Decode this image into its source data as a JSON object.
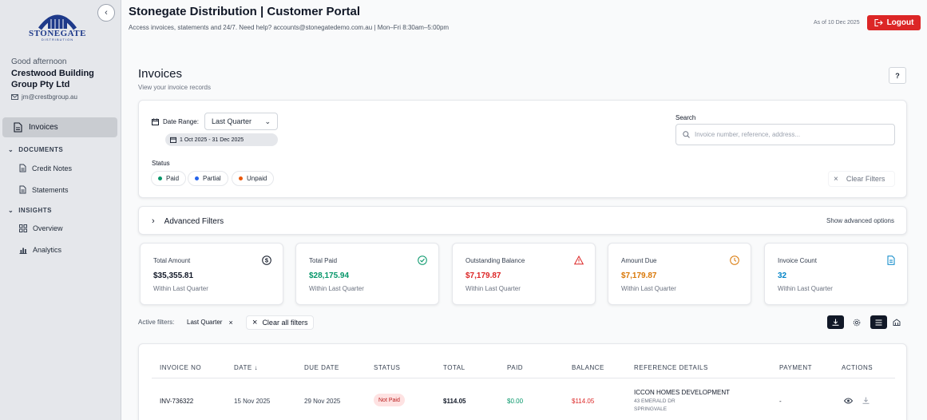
{
  "app": {
    "title": "Stonegate Distribution | Customer Portal",
    "subtitle": "Access invoices, statements and 24/7. Need help? accounts@stonegatedemo.com.au | Mon–Fri 8:30am–5:00pm",
    "as_of": "As of 10 Dec 2025",
    "logout_label": "Logout",
    "logo_text": "STONEGATE",
    "logo_sub": "DISTRIBUTION"
  },
  "user": {
    "greeting": "Good afternoon",
    "company": "Crestwood Building Group Pty Ltd",
    "email": "jm@crestbgroup.au"
  },
  "sidebar": {
    "active_item": "Invoices",
    "sections": [
      {
        "label": "DOCUMENTS",
        "items": [
          "Credit Notes",
          "Statements"
        ]
      },
      {
        "label": "INSIGHTS",
        "items": [
          "Overview",
          "Analytics"
        ]
      }
    ]
  },
  "page": {
    "title": "Invoices",
    "subtitle": "View your invoice records",
    "help_label": "?"
  },
  "filters": {
    "date_range_label": "Date Range:",
    "date_range_value": "Last Quarter",
    "date_span": "1 Oct 2025 - 31 Dec 2025",
    "search_label": "Search",
    "search_placeholder": "Invoice number, reference, address...",
    "status_label": "Status",
    "statuses": [
      {
        "label": "Paid",
        "color": "#059669"
      },
      {
        "label": "Partial",
        "color": "#2563eb"
      },
      {
        "label": "Unpaid",
        "color": "#ea580c"
      }
    ],
    "clear_label": "Clear Filters",
    "advanced_label": "Advanced Filters",
    "advanced_right": "Show advanced options"
  },
  "stats": [
    {
      "label": "Total Amount",
      "value": "$35,355.81",
      "sub": "Within Last Quarter",
      "color": "#111827",
      "icon": "dollar-icon"
    },
    {
      "label": "Total Paid",
      "value": "$28,175.94",
      "sub": "Within Last Quarter",
      "color": "#059669",
      "icon": "check-circle-icon"
    },
    {
      "label": "Outstanding Balance",
      "value": "$7,179.87",
      "sub": "Within Last Quarter",
      "color": "#dc2626",
      "icon": "warning-icon"
    },
    {
      "label": "Amount Due",
      "value": "$7,179.87",
      "sub": "Within Last Quarter",
      "color": "#d97706",
      "icon": "clock-icon"
    },
    {
      "label": "Invoice Count",
      "value": "32",
      "sub": "Within Last Quarter",
      "color": "#0284c7",
      "icon": "document-icon"
    }
  ],
  "active_filters": {
    "label": "Active filters:",
    "chips": [
      "Last Quarter"
    ],
    "clear_all_label": "Clear all filters"
  },
  "table": {
    "headers": [
      "INVOICE NO",
      "DATE ↓",
      "DUE DATE",
      "STATUS",
      "TOTAL",
      "PAID",
      "BALANCE",
      "REFERENCE DETAILS",
      "PAYMENT",
      "ACTIONS"
    ],
    "rows": [
      {
        "invoice_no": "INV-736322",
        "date": "15 Nov 2025",
        "due_date": "29 Nov 2025",
        "status": "Not Paid",
        "total": "$114.05",
        "paid": "$0.00",
        "balance": "$114.05",
        "ref_name": "ICCON HOMES DEVELOPMENT",
        "ref_line1": "43 EMERALD DR",
        "ref_line2": "SPRINGVALE",
        "payment": "-"
      }
    ]
  },
  "colors": {
    "accent_red": "#dc2626",
    "paid_green": "#059669",
    "balance_red": "#dc2626"
  }
}
